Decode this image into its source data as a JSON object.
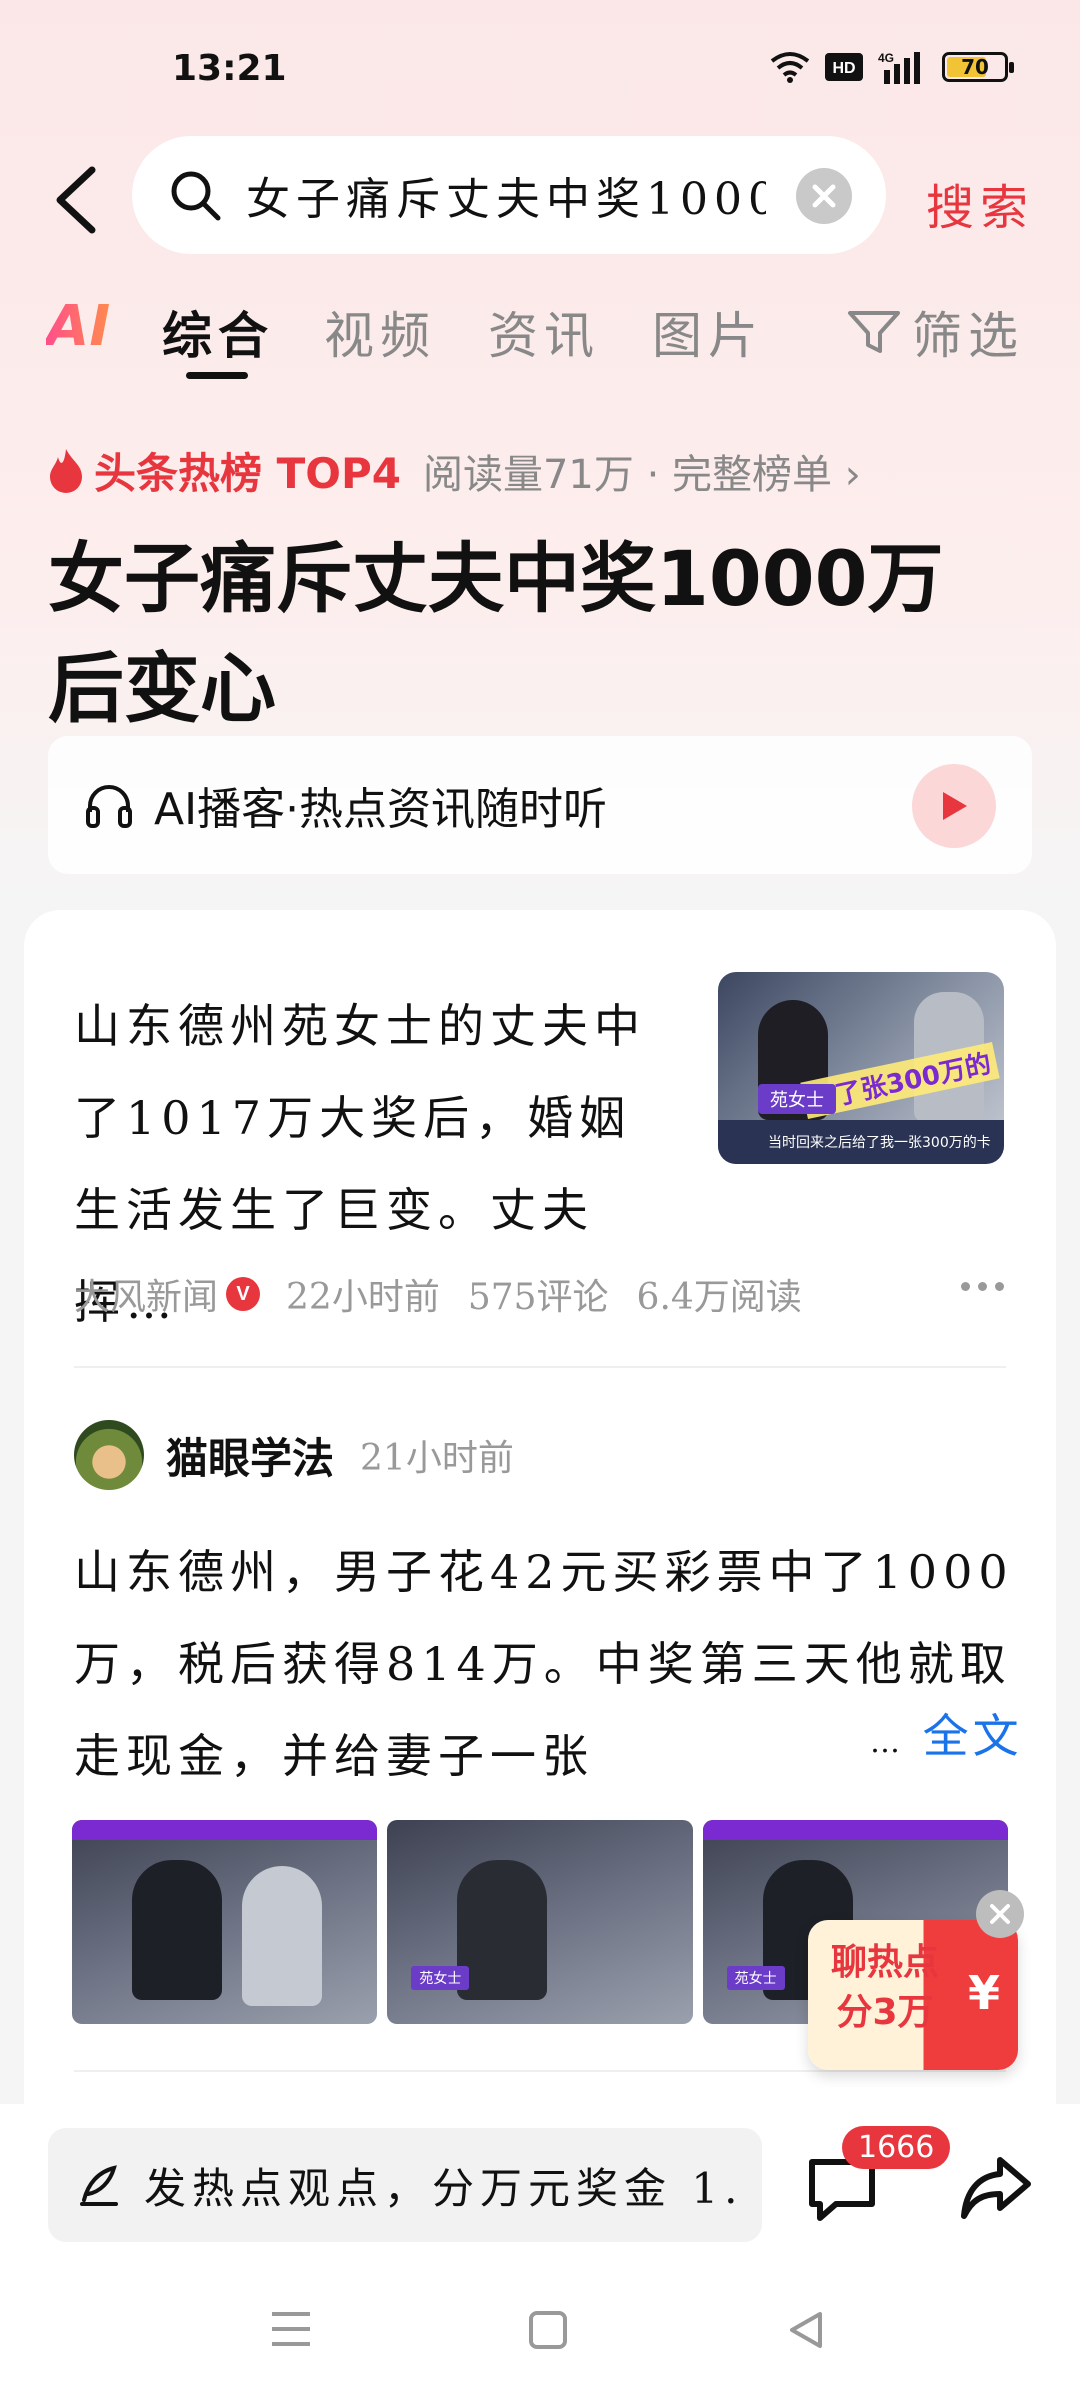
{
  "status_bar": {
    "time": "13:21",
    "battery_level": "70",
    "battery_fraction": 0.7,
    "icons": [
      "wifi-icon",
      "hd-icon",
      "4g-signal-icon",
      "battery-icon"
    ]
  },
  "search": {
    "query": "女子痛斥丈夫中奖1000",
    "submit_label": "搜索"
  },
  "tabs": {
    "ai_label": "AI",
    "items": [
      "综合",
      "视频",
      "资讯",
      "图片"
    ],
    "active_index": 0,
    "filter_label": "筛选"
  },
  "hot_list": {
    "label": "头条热榜 TOP4",
    "meta": "阅读量71万 · 完整榜单 ›",
    "title": "女子痛斥丈夫中奖1000万后变心"
  },
  "podcast": {
    "label": "AI播客·热点资讯随时听"
  },
  "results": [
    {
      "text": "山东德州苑女士的丈夫中了1017万大奖后，婚姻生活发生了巨变。丈夫挥…",
      "thumb_headline": "给了张300万的",
      "thumb_tag": "苑女士",
      "thumb_caption": "当时回来之后给了我一张300万的卡",
      "source": "大风新闻",
      "verified_badge": "V",
      "time": "22小时前",
      "comments": "575评论",
      "reads": "6.4万阅读"
    },
    {
      "author": "猫眼学法",
      "time": "21小时前",
      "text": "山东德州，男子花42元买彩票中了1000万，税后获得814万。中奖第三天他就取走现金，并给妻子一张",
      "expand_dots": "…",
      "expand_label": "全文",
      "image_tags": [
        "",
        "苑女士",
        "苑女士"
      ]
    }
  ],
  "promo": {
    "text": "聊热点分3万",
    "yen": "¥"
  },
  "bottom_bar": {
    "comment_placeholder": "发热点观点，分万元奖金 1.",
    "comment_count": "1666"
  },
  "colors": {
    "accent_red": "#e8363f",
    "link_blue": "#1a73e8"
  }
}
